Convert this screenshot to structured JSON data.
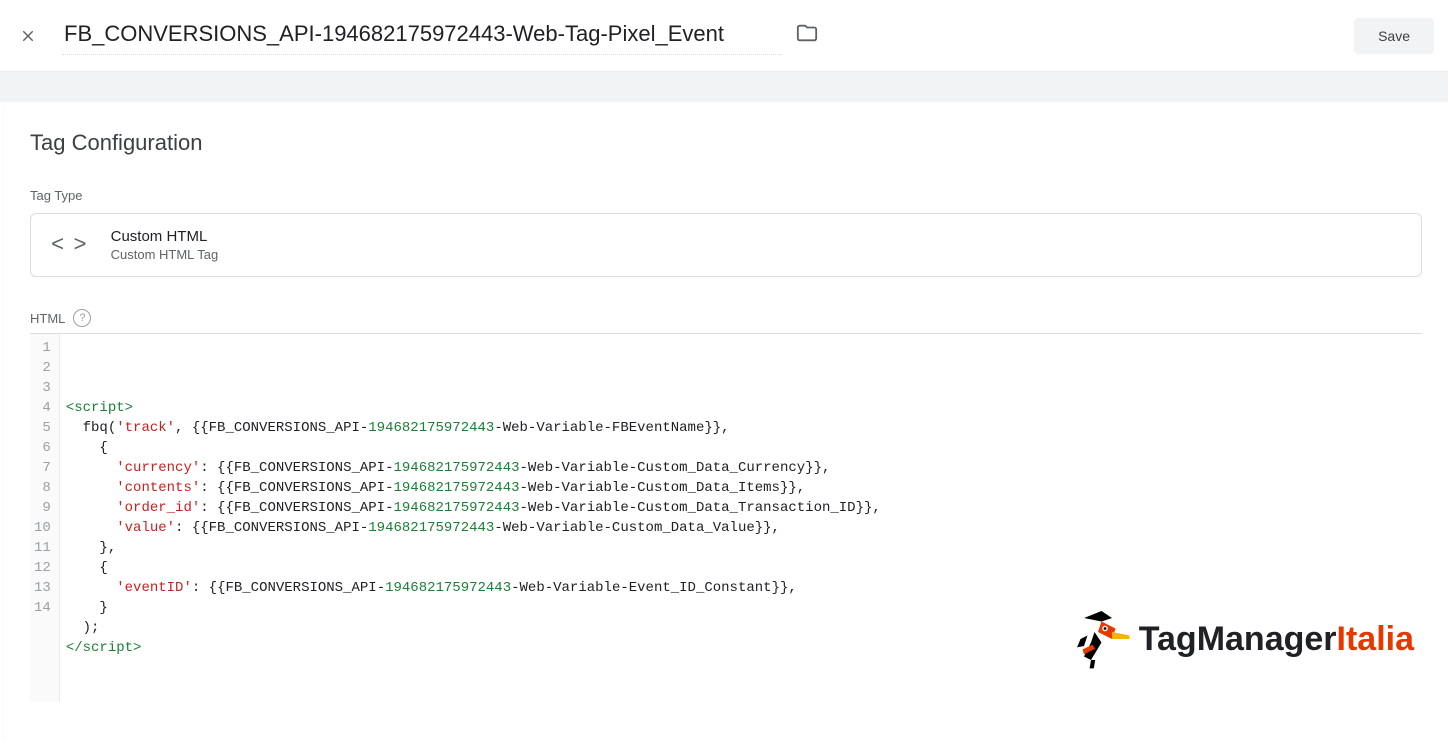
{
  "header": {
    "title": "FB_CONVERSIONS_API-194682175972443-Web-Tag-Pixel_Event",
    "save_label": "Save"
  },
  "config": {
    "heading": "Tag Configuration",
    "type_label": "Tag Type",
    "type_name": "Custom HTML",
    "type_sub": "Custom HTML Tag",
    "html_label": "HTML"
  },
  "code": {
    "lines": [
      {
        "n": "1",
        "segments": []
      },
      {
        "n": "2",
        "segments": [
          {
            "t": "<script>",
            "c": "tag"
          }
        ]
      },
      {
        "n": "3",
        "segments": [
          {
            "t": "  fbq(",
            "c": "plain"
          },
          {
            "t": "'track'",
            "c": "str"
          },
          {
            "t": ", {{FB_CONVERSIONS_API-",
            "c": "plain"
          },
          {
            "t": "194682175972443",
            "c": "num"
          },
          {
            "t": "-Web-Variable-FBEventName}},",
            "c": "plain"
          }
        ]
      },
      {
        "n": "4",
        "segments": [
          {
            "t": "    {",
            "c": "plain"
          }
        ]
      },
      {
        "n": "5",
        "segments": [
          {
            "t": "      ",
            "c": "plain"
          },
          {
            "t": "'currency'",
            "c": "str"
          },
          {
            "t": ": {{FB_CONVERSIONS_API-",
            "c": "plain"
          },
          {
            "t": "194682175972443",
            "c": "num"
          },
          {
            "t": "-Web-Variable-Custom_Data_Currency}},",
            "c": "plain"
          }
        ]
      },
      {
        "n": "6",
        "segments": [
          {
            "t": "      ",
            "c": "plain"
          },
          {
            "t": "'contents'",
            "c": "str"
          },
          {
            "t": ": {{FB_CONVERSIONS_API-",
            "c": "plain"
          },
          {
            "t": "194682175972443",
            "c": "num"
          },
          {
            "t": "-Web-Variable-Custom_Data_Items}},",
            "c": "plain"
          }
        ]
      },
      {
        "n": "7",
        "segments": [
          {
            "t": "      ",
            "c": "plain"
          },
          {
            "t": "'order_id'",
            "c": "str"
          },
          {
            "t": ": {{FB_CONVERSIONS_API-",
            "c": "plain"
          },
          {
            "t": "194682175972443",
            "c": "num"
          },
          {
            "t": "-Web-Variable-Custom_Data_Transaction_ID}},",
            "c": "plain"
          }
        ]
      },
      {
        "n": "8",
        "segments": [
          {
            "t": "      ",
            "c": "plain"
          },
          {
            "t": "'value'",
            "c": "str"
          },
          {
            "t": ": {{FB_CONVERSIONS_API-",
            "c": "plain"
          },
          {
            "t": "194682175972443",
            "c": "num"
          },
          {
            "t": "-Web-Variable-Custom_Data_Value}},",
            "c": "plain"
          }
        ]
      },
      {
        "n": "9",
        "segments": [
          {
            "t": "    },",
            "c": "plain"
          }
        ]
      },
      {
        "n": "10",
        "segments": [
          {
            "t": "    {",
            "c": "plain"
          }
        ]
      },
      {
        "n": "11",
        "segments": [
          {
            "t": "      ",
            "c": "plain"
          },
          {
            "t": "'eventID'",
            "c": "str"
          },
          {
            "t": ": {{FB_CONVERSIONS_API-",
            "c": "plain"
          },
          {
            "t": "194682175972443",
            "c": "num"
          },
          {
            "t": "-Web-Variable-Event_ID_Constant}},",
            "c": "plain"
          }
        ]
      },
      {
        "n": "12",
        "segments": [
          {
            "t": "    }",
            "c": "plain"
          }
        ]
      },
      {
        "n": "13",
        "segments": [
          {
            "t": "  );",
            "c": "plain"
          }
        ]
      },
      {
        "n": "14",
        "segments": [
          {
            "t": "</scr",
            "c": "tag"
          },
          {
            "t": "ipt>",
            "c": "tag"
          }
        ]
      }
    ]
  },
  "watermark": {
    "brand_a": "TagManager",
    "brand_b": "Italia"
  }
}
